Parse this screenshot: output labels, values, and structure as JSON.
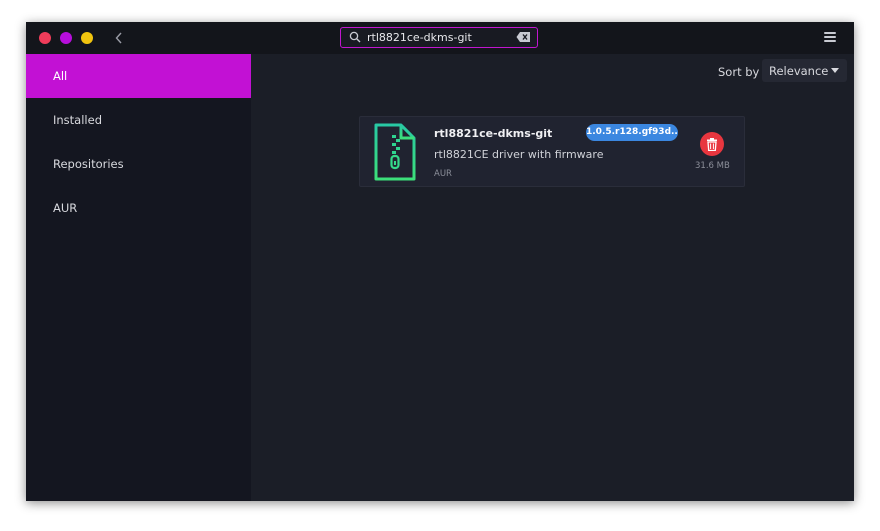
{
  "titlebar": {
    "search": {
      "value": "rtl8821ce-dkms-git",
      "placeholder": ""
    }
  },
  "sidebar": {
    "items": [
      {
        "label": "All",
        "active": true
      },
      {
        "label": "Installed",
        "active": false
      },
      {
        "label": "Repositories",
        "active": false
      },
      {
        "label": "AUR",
        "active": false
      }
    ]
  },
  "toolbar": {
    "sort_label": "Sort by",
    "sort_value": "Relevance"
  },
  "package": {
    "name": "rtl8821ce-dkms-git",
    "version": "1.0.5.r128.gf93d...",
    "description": "rtl8821CE driver with firmware",
    "repo": "AUR",
    "size": "31.6 MB"
  },
  "colors": {
    "accent": "#c211d4",
    "badge": "#3b87e0",
    "remove": "#e8363f",
    "window_bg": "#1b1e27",
    "sidebar_bg": "#141620"
  },
  "icons": [
    "search-icon",
    "clear-icon",
    "back-icon",
    "hamburger-menu-icon",
    "archive-file-icon",
    "trash-icon"
  ]
}
